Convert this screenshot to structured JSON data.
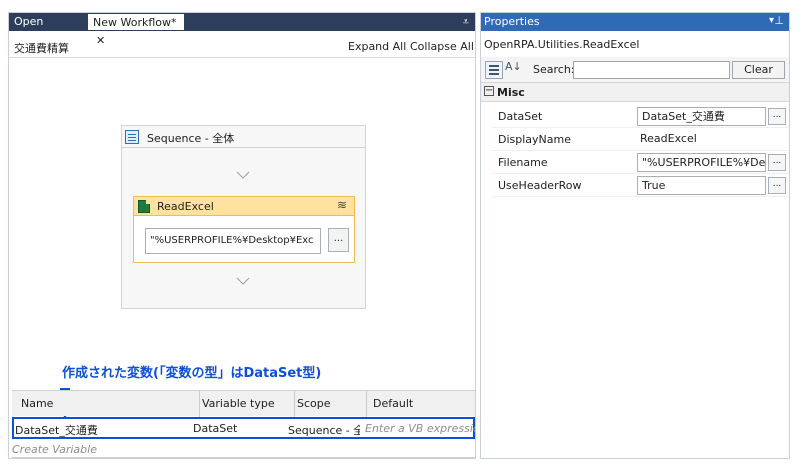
{
  "workflow_tabs": {
    "open_project": "Open project",
    "new_workflow": "New Workflow*",
    "close_symbol": "✕",
    "menu_symbol": "⩡"
  },
  "designer": {
    "breadcrumb": "交通費精算",
    "expand_all": "Expand All",
    "collapse_all": "Collapse All",
    "sequence_title": "Sequence - 全体",
    "readexcel_title": "ReadExcel",
    "collapse_icon": "≋",
    "filename_value": "\"%USERPROFILE%¥Desktop¥Exc",
    "filename_button": "...",
    "annotation": "作成された変数(「変数の型」はDataSet型)"
  },
  "variables": {
    "columns": [
      "Name",
      "Variable type",
      "Scope",
      "Default"
    ],
    "row": {
      "name": "DataSet_交通費",
      "type": "DataSet",
      "scope": "Sequence - 全",
      "default_placeholder": "Enter a VB expressio"
    },
    "create_variable": "Create Variable"
  },
  "properties": {
    "title": "Properties",
    "dropdown_symbol": "▾",
    "pin_symbol": "⊥",
    "object_name": "OpenRPA.Utilities.ReadExcel",
    "sort_symbol": "A↓",
    "search_label": "Search:",
    "search_value": "",
    "clear_button": "Clear",
    "misc_expander": "−",
    "misc_label": "Misc",
    "rows": [
      {
        "name": "DataSet",
        "value": "DataSet_交通費",
        "button": "..."
      },
      {
        "name": "DisplayName",
        "value": "ReadExcel"
      },
      {
        "name": "Filename",
        "value": "\"%USERPROFILE%¥Desk",
        "button": "..."
      },
      {
        "name": "UseHeaderRow",
        "value": "True",
        "button": "..."
      }
    ]
  },
  "colors": {
    "header_navy": "#2d3e5c",
    "properties_blue": "#2f6ab7",
    "annotation_blue": "#0d4fd6",
    "activity_yellow": "#ffe2a0"
  }
}
